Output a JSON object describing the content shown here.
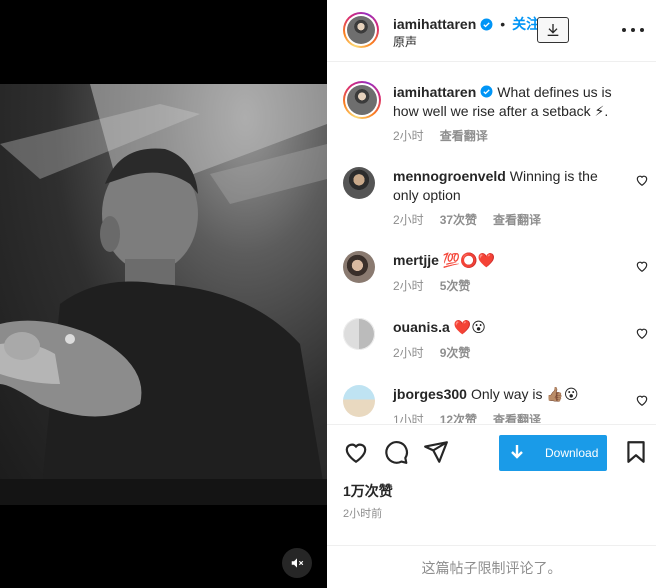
{
  "post": {
    "username": "iamihattaren",
    "follow_label": "关注",
    "audio": "原声",
    "caption": "What defines us is how well we rise after a setback ⚡.",
    "caption_time": "2小时",
    "caption_translate": "查看翻译"
  },
  "comments": [
    {
      "username": "mennogroenveld",
      "text": "Winning is the only option",
      "time": "2小时",
      "likes": "37次赞",
      "translate": "查看翻译"
    },
    {
      "username": "mertjje",
      "text": "💯⭕❤️",
      "time": "2小时",
      "likes": "5次赞",
      "translate": ""
    },
    {
      "username": "ouanis.a",
      "text": "❤️😮",
      "time": "2小时",
      "likes": "9次赞",
      "translate": ""
    },
    {
      "username": "jborges300",
      "text": "Only way is 👍🏽😮",
      "time": "1小时",
      "likes": "12次赞",
      "translate": "查看翻译"
    }
  ],
  "actions": {
    "download_label": "Download",
    "likes_count": "1万次赞",
    "posted_time": "2小时前",
    "comments_limited": "这篇帖子限制评论了。"
  },
  "colors": {
    "accent": "#0095f6",
    "download_bg": "#1a9be8",
    "muted_text": "#8e8e8e"
  },
  "icons": [
    "verified-icon",
    "download-icon",
    "more-options-icon",
    "heart-icon",
    "comment-icon",
    "share-icon",
    "bookmark-icon",
    "mute-icon"
  ]
}
